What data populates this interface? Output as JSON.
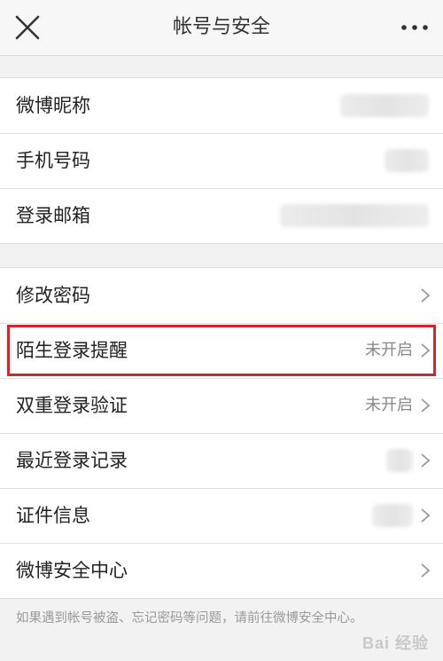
{
  "header": {
    "title": "帐号与安全"
  },
  "group1": [
    {
      "label": "微博昵称"
    },
    {
      "label": "手机号码"
    },
    {
      "label": "登录邮箱"
    }
  ],
  "group2": [
    {
      "label": "修改密码",
      "value": ""
    },
    {
      "label": "陌生登录提醒",
      "value": "未开启"
    },
    {
      "label": "双重登录验证",
      "value": "未开启"
    },
    {
      "label": "最近登录记录",
      "value": ""
    },
    {
      "label": "证件信息",
      "value": ""
    },
    {
      "label": "微博安全中心",
      "value": ""
    }
  ],
  "footer": {
    "text": "如果遇到帐号被盗、忘记密码等问题，请前往微博安全中心。"
  },
  "watermark": {
    "text": "Bai 经验"
  },
  "colors": {
    "highlight": "#d9232a",
    "background": "#f2f2f2"
  }
}
